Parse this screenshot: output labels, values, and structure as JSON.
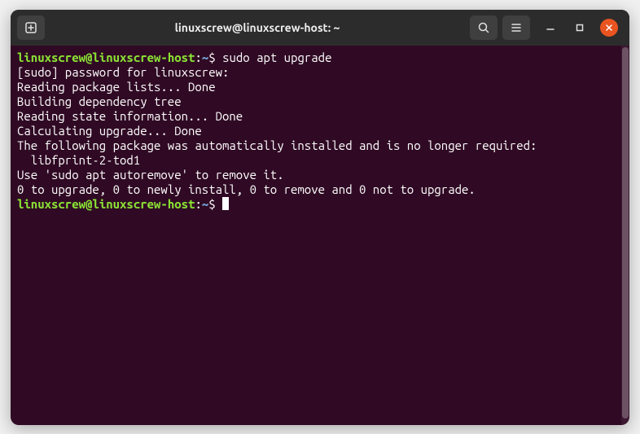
{
  "window": {
    "title": "linuxscrew@linuxscrew-host: ~"
  },
  "prompt": {
    "user": "linuxscrew",
    "at": "@",
    "host": "linuxscrew-host",
    "colon": ":",
    "path": "~",
    "dollar": "$ "
  },
  "lines": {
    "cmd1": "sudo apt upgrade",
    "out1": "[sudo] password for linuxscrew:",
    "out2": "Reading package lists... Done",
    "out3": "Building dependency tree",
    "out4": "Reading state information... Done",
    "out5": "Calculating upgrade... Done",
    "out6": "The following package was automatically installed and is no longer required:",
    "out7": "  libfprint-2-tod1",
    "out8": "Use 'sudo apt autoremove' to remove it.",
    "out9": "0 to upgrade, 0 to newly install, 0 to remove and 0 not to upgrade."
  }
}
